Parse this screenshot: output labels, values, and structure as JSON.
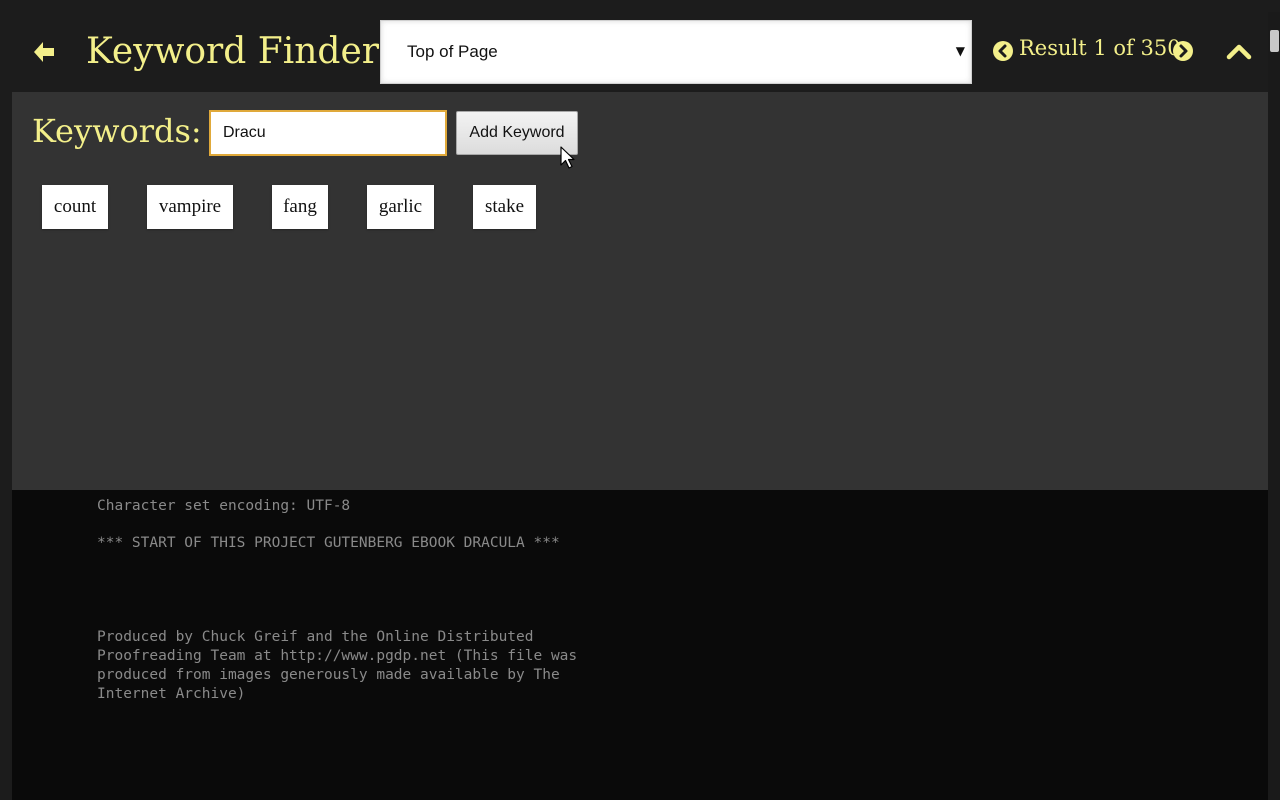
{
  "header": {
    "title": "Keyword Finder",
    "select_value": "Top of Page",
    "select_arrow": "▼",
    "result_text": "Result 1 of 350"
  },
  "keywords": {
    "label": "Keywords:",
    "input_value": "Dracu",
    "add_button_label": "Add Keyword",
    "chips": [
      "count",
      "vampire",
      "fang",
      "garlic",
      "stake"
    ]
  },
  "document": {
    "lines": [
      "Character set encoding: UTF-8",
      "*** START OF THIS PROJECT GUTENBERG EBOOK DRACULA ***",
      "Produced by Chuck Greif and the Online Distributed",
      "Proofreading Team at http://www.pgdp.net (This file was",
      "produced from images generously made available by The",
      "Internet Archive)"
    ]
  },
  "colors": {
    "accent": "#f3ef8a",
    "header_bg": "#1c1c1c",
    "panel_bg": "#333333",
    "doc_bg": "#0a0a0a",
    "input_border": "#e0a93a"
  },
  "icons": {
    "back": "arrow-left-icon",
    "prev": "chevron-circle-left-icon",
    "next": "chevron-circle-right-icon",
    "up": "chevron-up-icon"
  }
}
